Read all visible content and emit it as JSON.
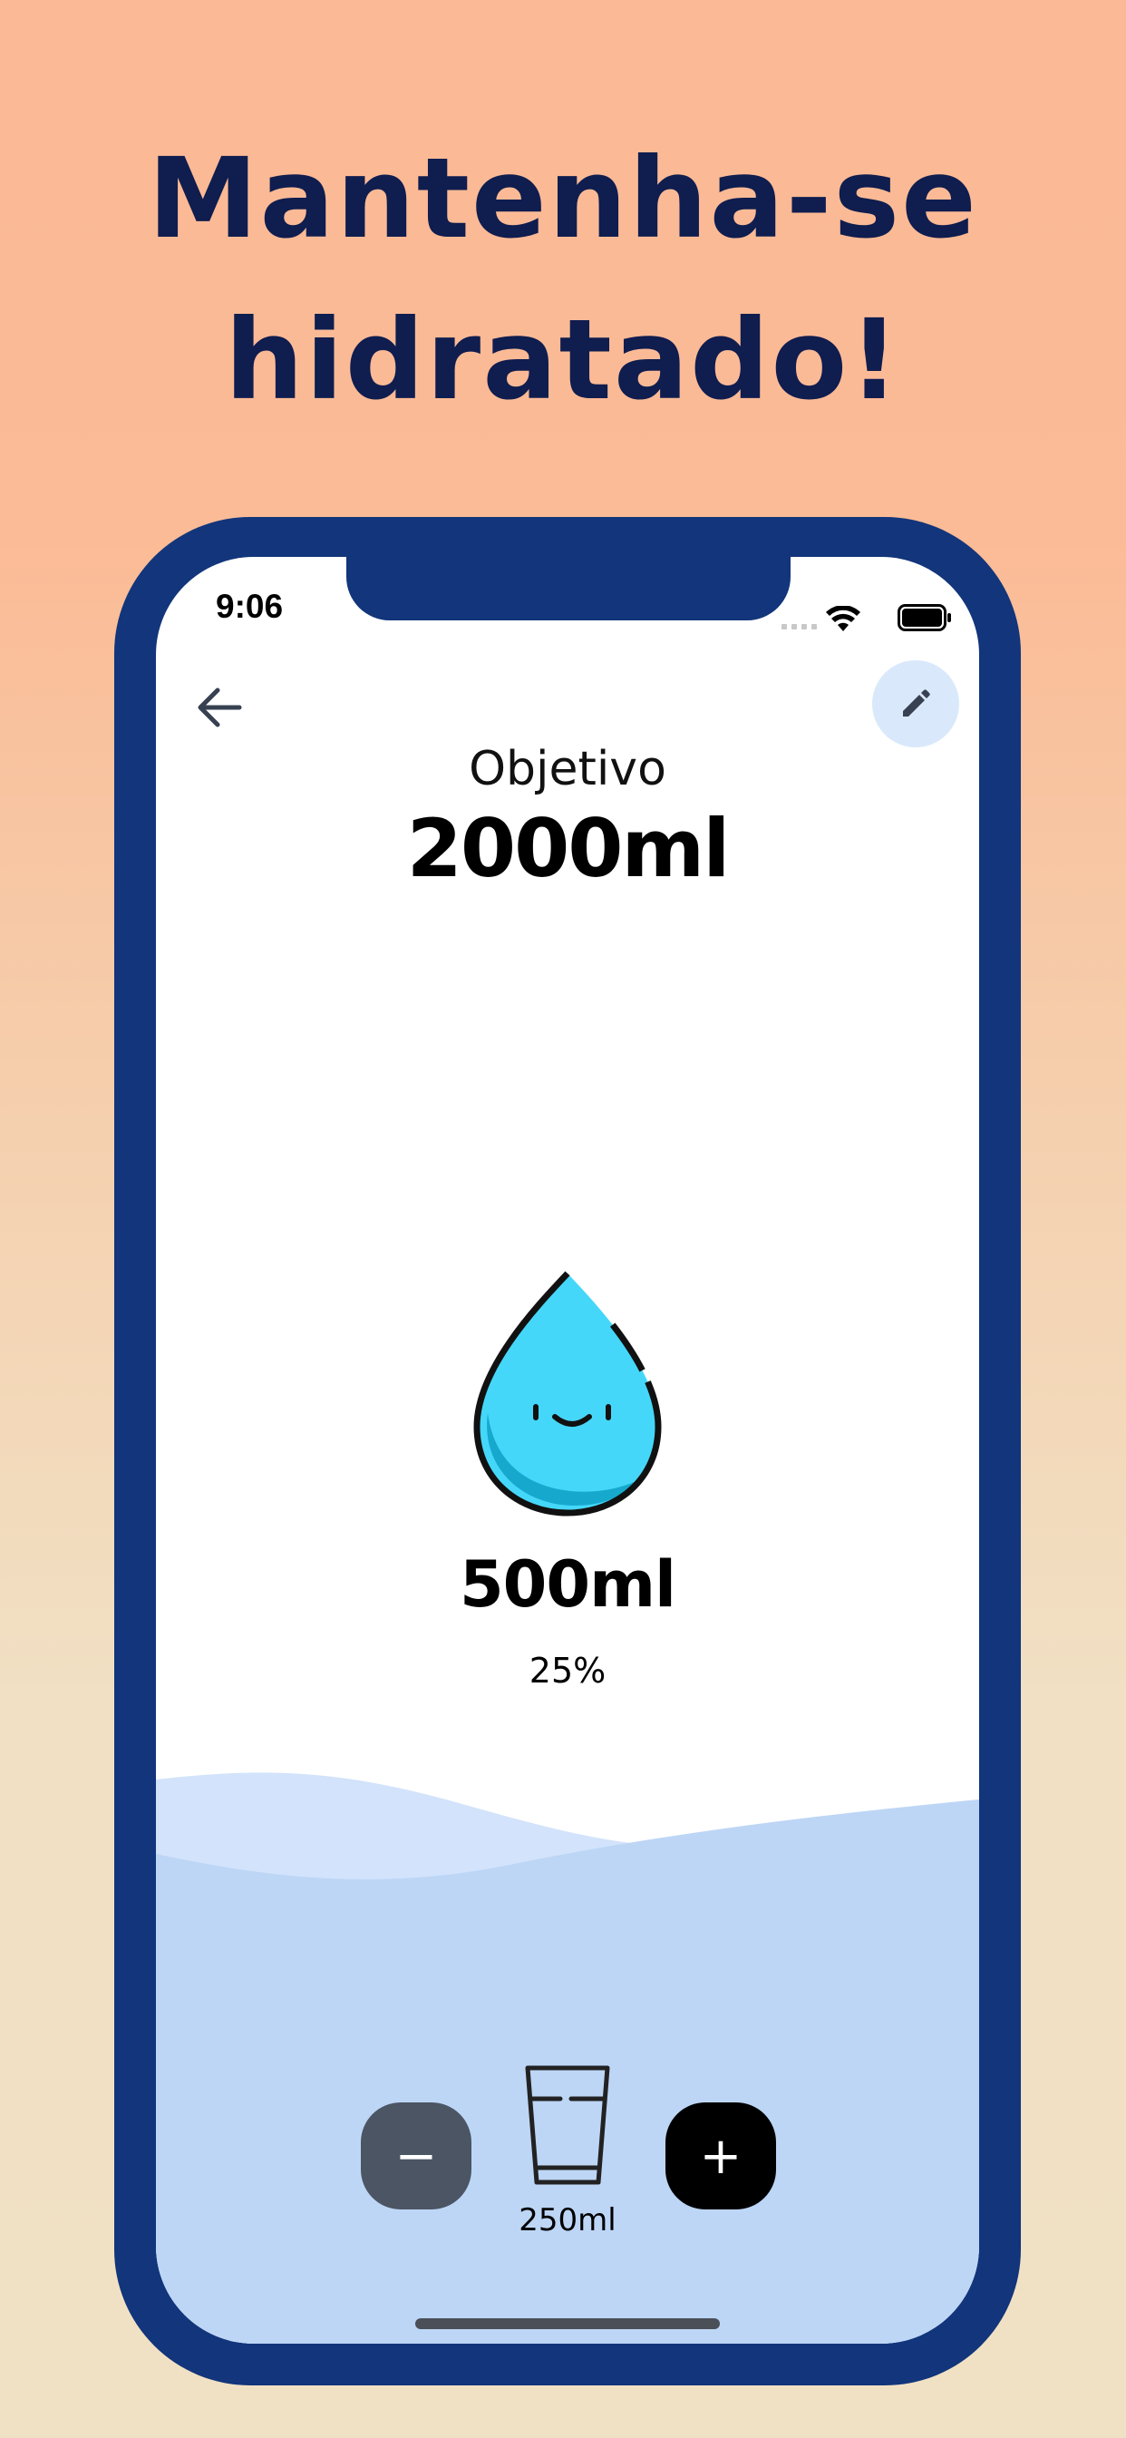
{
  "headline": {
    "line1": "Mantenha-se",
    "line2": "hidratado!"
  },
  "status_bar": {
    "time": "9:06",
    "signal_icon": "signal-icon",
    "wifi_icon": "wifi-icon",
    "battery_icon": "battery-icon"
  },
  "toolbar": {
    "back_icon": "arrow-left-icon",
    "edit_icon": "pencil-icon"
  },
  "goal": {
    "label": "Objetivo",
    "value": "2000ml"
  },
  "progress": {
    "consumed": "500ml",
    "percent": "25%",
    "fraction": 0.25
  },
  "controls": {
    "decrease": "−",
    "increase": "+",
    "glass_size": "250ml",
    "glass_icon": "glass-icon"
  },
  "colors": {
    "frame": "#12357b",
    "headline": "#0f1d4f",
    "drop": "#45d7f9",
    "wave_light": "#d2e3fb",
    "wave_dark": "#bdd6f6",
    "minus_button": "#4b5563",
    "plus_button": "#000000"
  }
}
